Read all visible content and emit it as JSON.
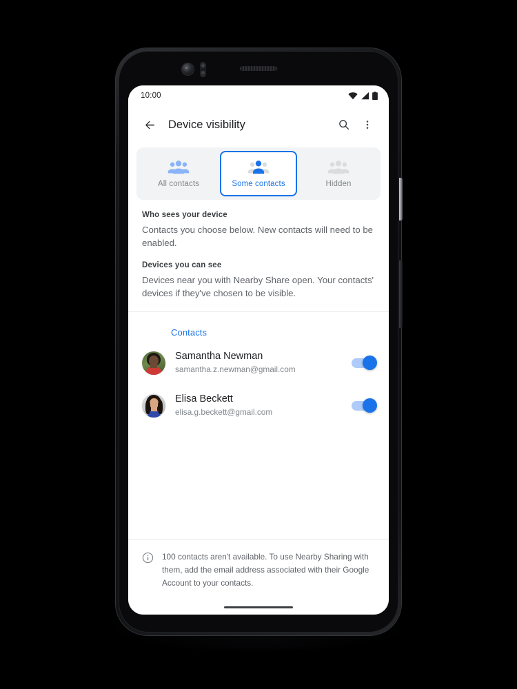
{
  "status_bar": {
    "time": "10:00",
    "icons": [
      "wifi-icon",
      "cellular-signal-icon",
      "battery-icon"
    ]
  },
  "app_bar": {
    "back_icon": "back-arrow-icon",
    "title": "Device visibility",
    "search_icon": "search-icon",
    "overflow_icon": "more-vert-icon"
  },
  "tabs": {
    "selected_index": 1,
    "items": [
      {
        "label": "All contacts",
        "icon": "people-group-icon",
        "state": "unselected"
      },
      {
        "label": "Some contacts",
        "icon": "person-highlighted-group-icon",
        "state": "selected"
      },
      {
        "label": "Hidden",
        "icon": "people-group-muted-icon",
        "state": "unselected"
      }
    ]
  },
  "description": {
    "groups": [
      {
        "title": "Who sees your device",
        "body": "Contacts you choose below. New contacts will need to be enabled."
      },
      {
        "title": "Devices you can see",
        "body": "Devices near you with Nearby Share open. Your contacts' devices if they've chosen to be visible."
      }
    ]
  },
  "contacts_section": {
    "header": "Contacts",
    "rows": [
      {
        "name": "Samantha Newman",
        "email": "samantha.z.newman@gmail.com",
        "toggle_on": true,
        "avatar": "contact-avatar-samantha"
      },
      {
        "name": "Elisa Beckett",
        "email": "elisa.g.beckett@gmail.com",
        "toggle_on": true,
        "avatar": "contact-avatar-elisa"
      }
    ]
  },
  "footer": {
    "icon": "info-circle-icon",
    "text": "100 contacts aren't available. To use Nearby Sharing with them, add the email address associated with their Google Account to your contacts."
  },
  "colors": {
    "accent_blue": "#1a73e8",
    "light_blue": "#8ab4f8",
    "track_blue": "#aecbfa",
    "text_primary": "#202124",
    "text_secondary": "#5f6368",
    "text_tertiary": "#80868b",
    "surface_grey": "#f1f3f4",
    "divider": "#e8eaed"
  }
}
